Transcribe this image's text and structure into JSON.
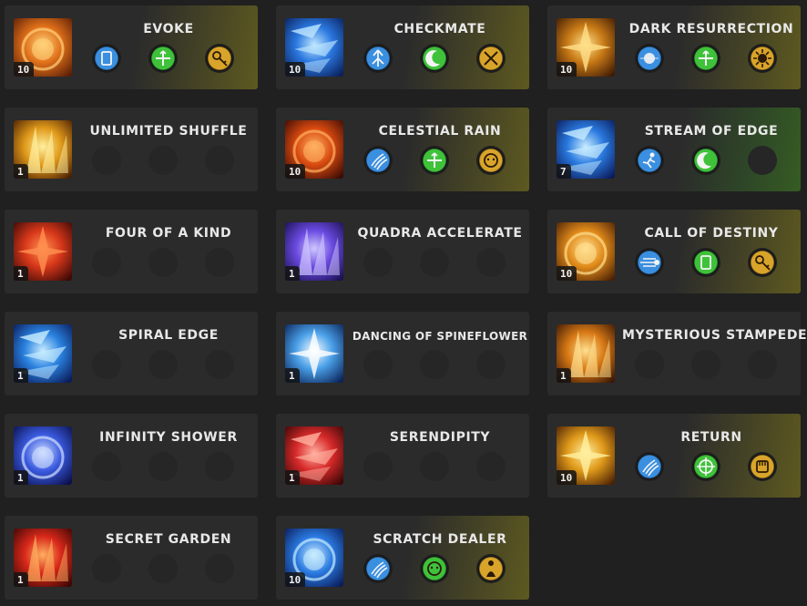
{
  "skills": [
    {
      "name": "EVOKE",
      "level": "10",
      "tint": "gold",
      "art": "evoke-art",
      "colors": [
        "#ffd27a",
        "#e0701a",
        "#5a1e06"
      ],
      "tripods": [
        {
          "icon": "card-icon",
          "color": "#3a8fe0"
        },
        {
          "icon": "cross-arrows-icon",
          "color": "#3fc23a"
        },
        {
          "icon": "keys-icon",
          "color": "#d9a42a"
        }
      ]
    },
    {
      "name": "CHECKMATE",
      "level": "10",
      "tint": "gold",
      "art": "checkmate-art",
      "colors": [
        "#bfe6ff",
        "#2a78e0",
        "#0a1f5a"
      ],
      "tripods": [
        {
          "icon": "burst-up-icon",
          "color": "#3a8fe0"
        },
        {
          "icon": "crescent-icon",
          "color": "#3fc23a"
        },
        {
          "icon": "crossed-swords-icon",
          "color": "#d9a42a"
        }
      ]
    },
    {
      "name": "DARK RESURRECTION",
      "level": "10",
      "tint": "gold",
      "art": "dark-resurrection-art",
      "colors": [
        "#ffe08a",
        "#c87a16",
        "#3e1a04"
      ],
      "tripods": [
        {
          "icon": "orb-icon",
          "color": "#3a8fe0"
        },
        {
          "icon": "cross-arrows-icon",
          "color": "#3fc23a"
        },
        {
          "icon": "sun-icon",
          "color": "#d9a42a"
        }
      ]
    },
    {
      "name": "UNLIMITED SHUFFLE",
      "level": "1",
      "tint": "none",
      "art": "unlimited-shuffle-art",
      "colors": [
        "#fff0a0",
        "#e09a1a",
        "#4a1e04"
      ],
      "tripods": []
    },
    {
      "name": "CELESTIAL RAIN",
      "level": "10",
      "tint": "gold",
      "art": "celestial-rain-art",
      "colors": [
        "#ffb060",
        "#d84a10",
        "#3a0a04"
      ],
      "tripods": [
        {
          "icon": "claw-marks-icon",
          "color": "#3a8fe0"
        },
        {
          "icon": "cross-arrows-icon",
          "color": "#3fc23a"
        },
        {
          "icon": "face-icon",
          "color": "#d9a42a"
        }
      ]
    },
    {
      "name": "STREAM OF EDGE",
      "level": "7",
      "tint": "green",
      "art": "stream-of-edge-art",
      "colors": [
        "#c8ecff",
        "#2a7ae0",
        "#0a1a58"
      ],
      "tripods": [
        {
          "icon": "dash-figure-icon",
          "color": "#3a8fe0"
        },
        {
          "icon": "crescent-icon",
          "color": "#3fc23a"
        }
      ]
    },
    {
      "name": "FOUR OF A KIND",
      "level": "1",
      "tint": "none",
      "art": "four-of-a-kind-art",
      "colors": [
        "#ff9050",
        "#d8381a",
        "#3a0806"
      ],
      "tripods": []
    },
    {
      "name": "QUADRA ACCELERATE",
      "level": "1",
      "tint": "none",
      "art": "quadra-accelerate-art",
      "colors": [
        "#d0c8ff",
        "#6a4ae0",
        "#1a1050"
      ],
      "tripods": []
    },
    {
      "name": "CALL OF DESTINY",
      "level": "10",
      "tint": "gold",
      "art": "call-of-destiny-art",
      "colors": [
        "#ffe090",
        "#e08a1a",
        "#4a2004"
      ],
      "tripods": [
        {
          "icon": "streak-icon",
          "color": "#3a8fe0"
        },
        {
          "icon": "card-icon",
          "color": "#3fc23a"
        },
        {
          "icon": "keys-icon",
          "color": "#d9a42a"
        }
      ]
    },
    {
      "name": "SPIRAL EDGE",
      "level": "1",
      "tint": "none",
      "art": "spiral-edge-art",
      "colors": [
        "#c8ecff",
        "#2a82e0",
        "#0a1a58"
      ],
      "tripods": []
    },
    {
      "name": "DANCING OF SPINEFLOWER",
      "level": "1",
      "tint": "none",
      "art": "dancing-of-spineflower-art",
      "colors": [
        "#ffffff",
        "#4aa0e8",
        "#0a2258"
      ],
      "tripods": []
    },
    {
      "name": "MYSTERIOUS STAMPEDE",
      "level": "1",
      "tint": "none",
      "art": "mysterious-stampede-art",
      "colors": [
        "#ffe090",
        "#d87a16",
        "#3a1604"
      ],
      "tripods": []
    },
    {
      "name": "INFINITY SHOWER",
      "level": "1",
      "tint": "none",
      "art": "infinity-shower-art",
      "colors": [
        "#d0e0ff",
        "#3a5ae0",
        "#0a0f48"
      ],
      "tripods": []
    },
    {
      "name": "SERENDIPITY",
      "level": "1",
      "tint": "none",
      "art": "serendipity-art",
      "colors": [
        "#ffb0a0",
        "#d82a2a",
        "#3a0606"
      ],
      "tripods": []
    },
    {
      "name": "RETURN",
      "level": "10",
      "tint": "gold",
      "art": "return-art",
      "colors": [
        "#fff0a0",
        "#e09a1a",
        "#4a2004"
      ],
      "tripods": [
        {
          "icon": "claw-marks-icon",
          "color": "#3a8fe0"
        },
        {
          "icon": "target-icon",
          "color": "#3fc23a"
        },
        {
          "icon": "fist-icon",
          "color": "#d9a42a"
        }
      ]
    },
    {
      "name": "SECRET GARDEN",
      "level": "1",
      "tint": "none",
      "art": "secret-garden-art",
      "colors": [
        "#ffb060",
        "#d8281a",
        "#3a0604"
      ],
      "tripods": []
    },
    {
      "name": "SCRATCH DEALER",
      "level": "10",
      "tint": "gold",
      "art": "scratch-dealer-art",
      "colors": [
        "#c8ecff",
        "#2a7ae0",
        "#0a1a58"
      ],
      "tripods": [
        {
          "icon": "claw-marks-icon",
          "color": "#3a8fe0"
        },
        {
          "icon": "face-icon",
          "color": "#3fc23a"
        },
        {
          "icon": "figure-icon",
          "color": "#d9a42a"
        }
      ]
    }
  ]
}
